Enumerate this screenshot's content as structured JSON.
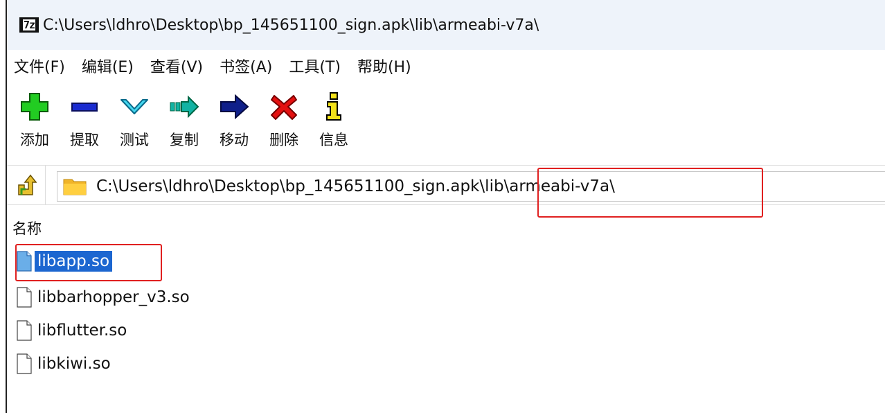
{
  "window": {
    "title": "C:\\Users\\ldhro\\Desktop\\bp_145651100_sign.apk\\lib\\armeabi-v7a\\",
    "app_icon_text": "7z"
  },
  "menu": [
    {
      "label": "文件(F)"
    },
    {
      "label": "编辑(E)"
    },
    {
      "label": "查看(V)"
    },
    {
      "label": "书签(A)"
    },
    {
      "label": "工具(T)"
    },
    {
      "label": "帮助(H)"
    }
  ],
  "toolbar": [
    {
      "label": "添加",
      "icon": "add-icon"
    },
    {
      "label": "提取",
      "icon": "extract-icon"
    },
    {
      "label": "测试",
      "icon": "test-icon"
    },
    {
      "label": "复制",
      "icon": "copy-icon"
    },
    {
      "label": "移动",
      "icon": "move-icon"
    },
    {
      "label": "删除",
      "icon": "delete-icon"
    },
    {
      "label": "信息",
      "icon": "info-icon"
    }
  ],
  "address": {
    "path": "C:\\Users\\ldhro\\Desktop\\bp_145651100_sign.apk\\lib\\armeabi-v7a\\"
  },
  "list": {
    "column_name": "名称",
    "files": [
      {
        "name": "libapp.so",
        "selected": true
      },
      {
        "name": "libbarhopper_v3.so",
        "selected": false
      },
      {
        "name": "libflutter.so",
        "selected": false
      },
      {
        "name": "libkiwi.so",
        "selected": false
      }
    ]
  },
  "colors": {
    "selection": "#1c66d0",
    "annotation": "#e02020",
    "titlebar": "#eef3fa"
  }
}
